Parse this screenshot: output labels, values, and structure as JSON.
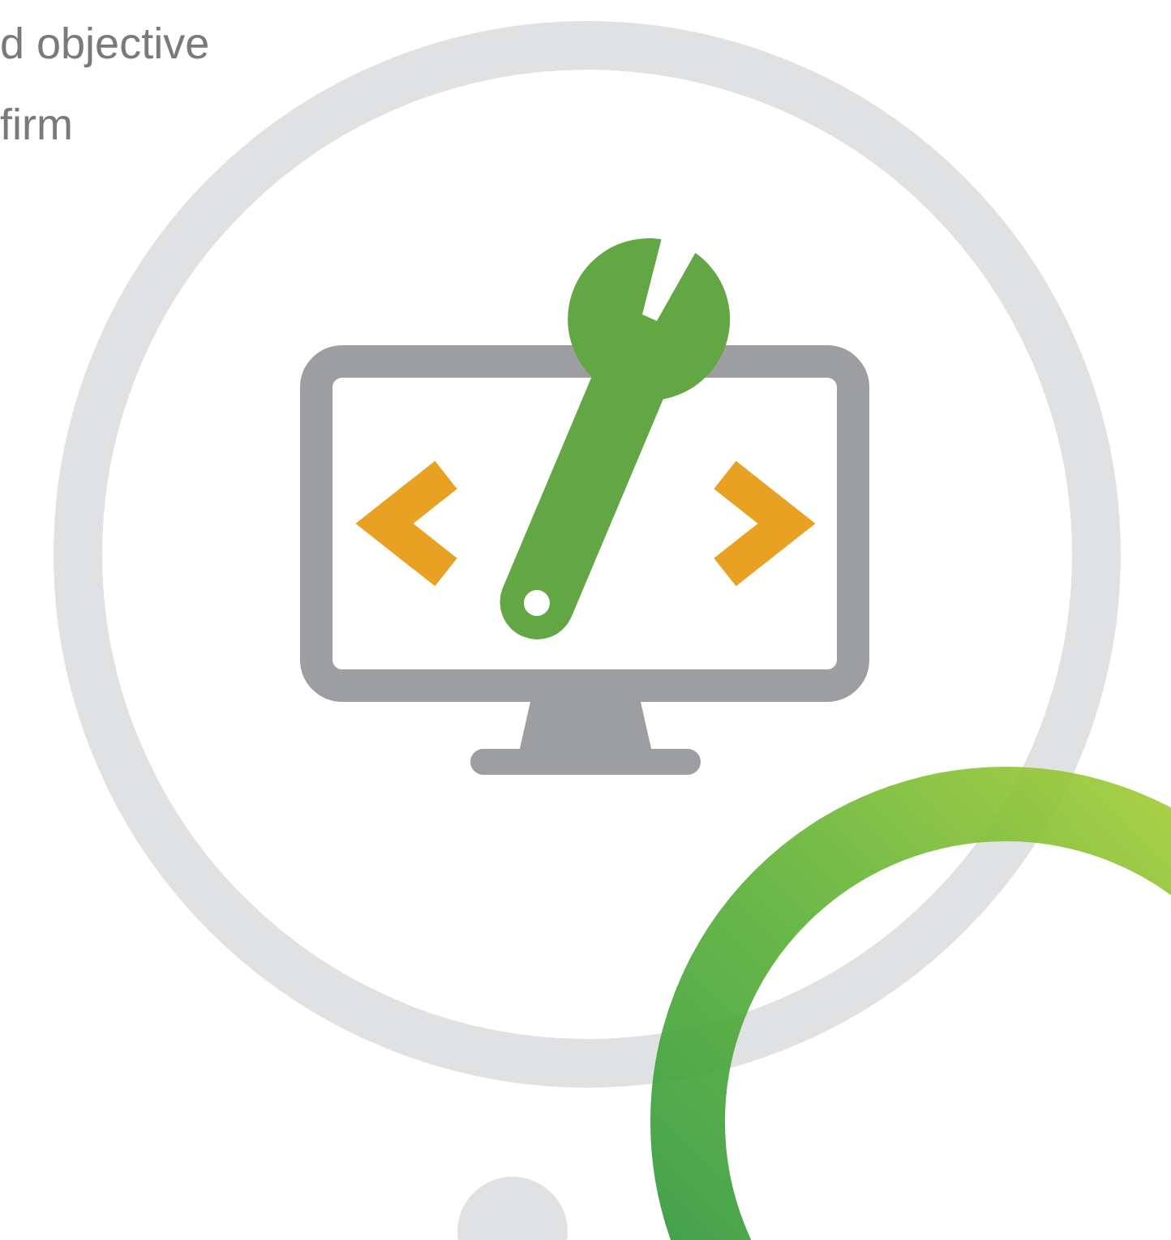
{
  "text_lines": [
    "d objective",
    "firm"
  ]
}
